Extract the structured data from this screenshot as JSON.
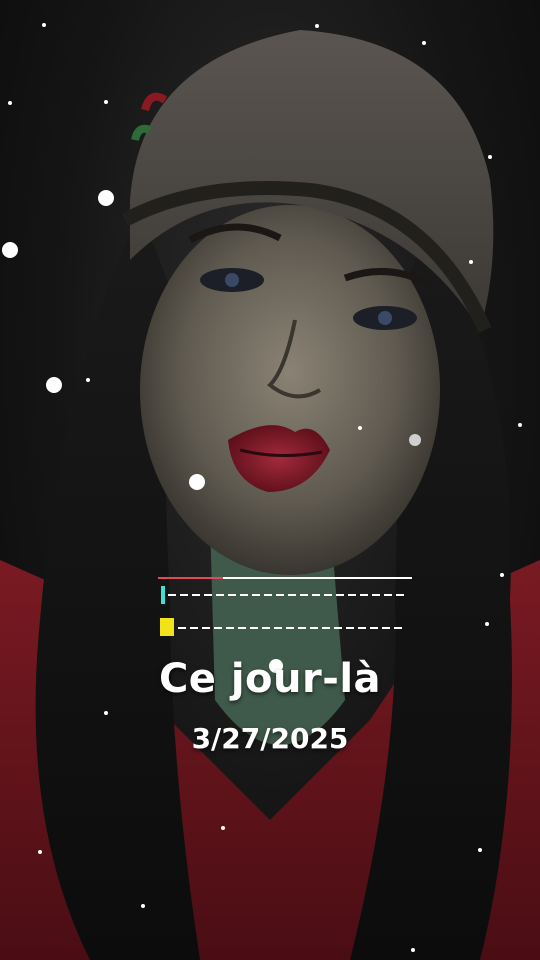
{
  "caption": {
    "title": "Ce jour-là",
    "date": "3/27/2025"
  },
  "colors": {
    "background": "#141414",
    "caption_text": "#ffffff",
    "progress_accent": "#e24a5a",
    "marker_cyan": "#3fe0d0",
    "marker_yellow": "#f2e21a"
  }
}
